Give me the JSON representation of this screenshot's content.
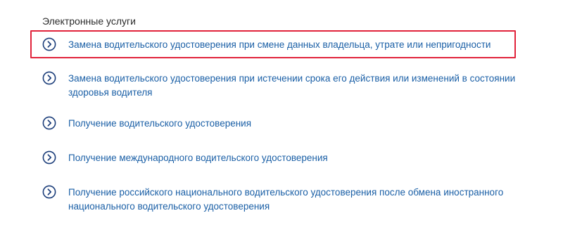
{
  "section": {
    "title": "Электронные услуги"
  },
  "services": [
    {
      "label": "Замена водительского удостоверения при смене данных владельца, утрате или непригодности",
      "icon": "chevron-right-circle-icon",
      "highlighted": true
    },
    {
      "label": "Замена водительского удостоверения при истечении срока его действия или изменений в состоянии здоровья водителя",
      "icon": "chevron-right-circle-icon",
      "highlighted": false
    },
    {
      "label": "Получение водительского удостоверения",
      "icon": "chevron-right-circle-icon",
      "highlighted": false
    },
    {
      "label": "Получение международного водительского удостоверения",
      "icon": "chevron-right-circle-icon",
      "highlighted": false
    },
    {
      "label": "Получение российского национального водительского удостоверения после обмена иностранного национального водительского удостоверения",
      "icon": "chevron-right-circle-icon",
      "highlighted": false
    }
  ],
  "colors": {
    "link": "#1a5fa6",
    "icon": "#1b3d7a",
    "highlight": "#e1233b",
    "title": "#2b2b2b"
  }
}
